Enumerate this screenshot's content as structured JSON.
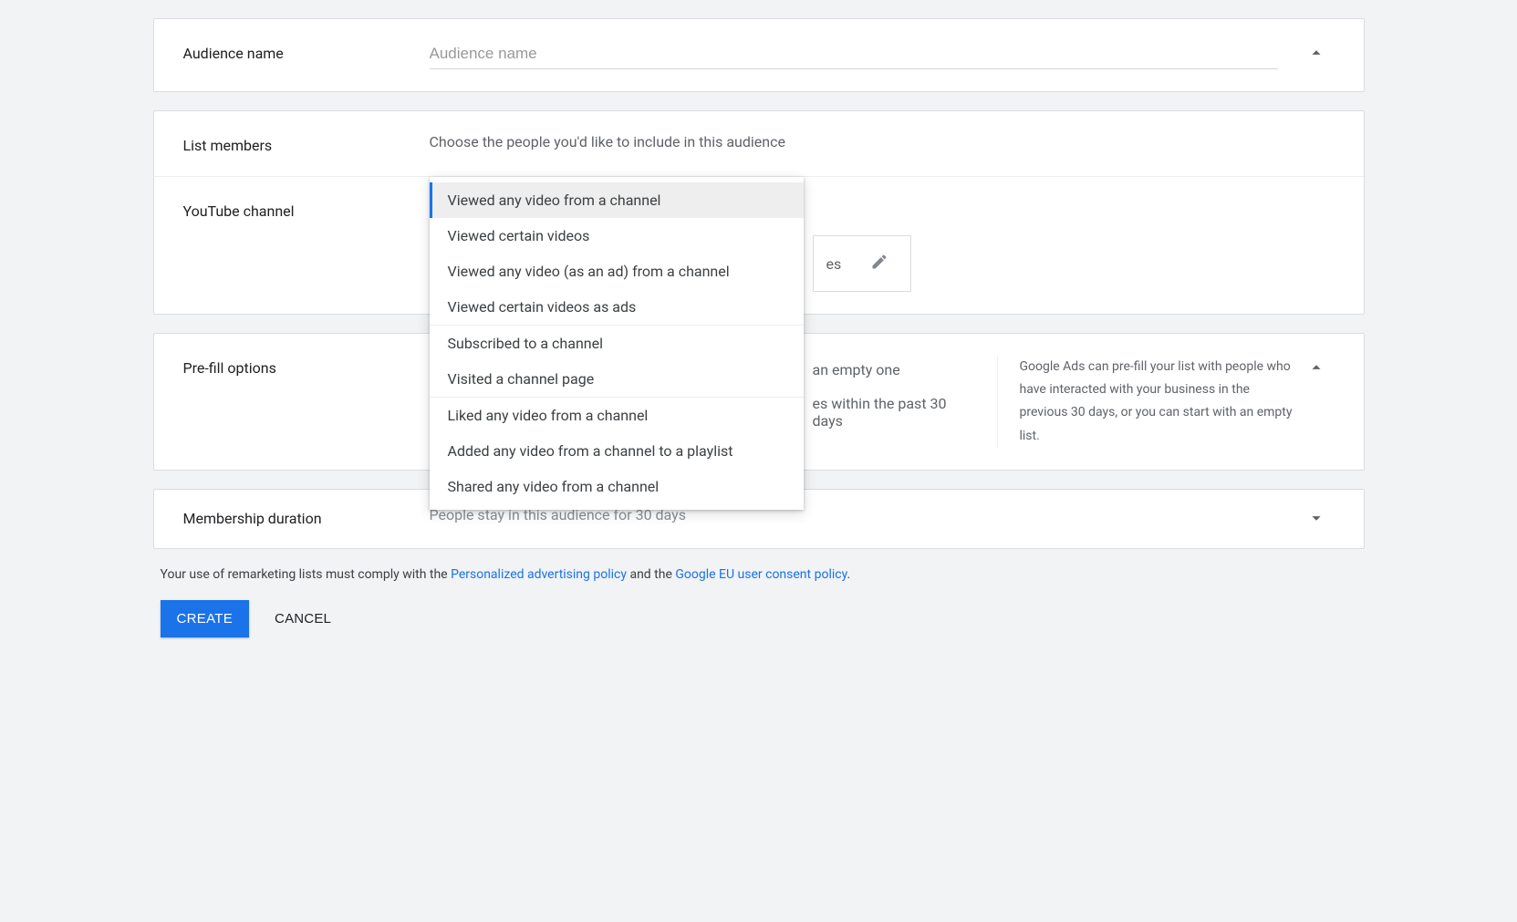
{
  "audience_name": {
    "label": "Audience name",
    "placeholder": "Audience name",
    "value": ""
  },
  "list_members": {
    "label": "List members",
    "hint": "Choose the people you'd like to include in this audience",
    "menu": {
      "groups": [
        [
          "Viewed any video from a channel",
          "Viewed certain videos",
          "Viewed any video (as an ad) from a channel",
          "Viewed certain videos as ads"
        ],
        [
          "Subscribed to a channel",
          "Visited a channel page"
        ],
        [
          "Liked any video from a channel",
          "Added any video from a channel to a playlist",
          "Shared any video from a channel"
        ]
      ],
      "selected": "Viewed any video from a channel"
    }
  },
  "youtube_channel": {
    "label": "YouTube channel",
    "chip_partial": "es"
  },
  "prefill": {
    "label": "Pre-fill options",
    "option1_partial": "an empty one",
    "option2_partial": "es within the past 30 days",
    "info": "Google Ads can pre-fill your list with people who have interacted with your business in the previous 30 days, or you can start with an empty list."
  },
  "membership": {
    "label": "Membership duration",
    "summary": "People stay in this audience for 30 days"
  },
  "footnote": {
    "prefix": "Your use of remarketing lists must comply with the ",
    "link1": "Personalized advertising policy",
    "mid": " and the ",
    "link2": "Google EU user consent policy",
    "suffix": "."
  },
  "buttons": {
    "create": "CREATE",
    "cancel": "CANCEL"
  }
}
